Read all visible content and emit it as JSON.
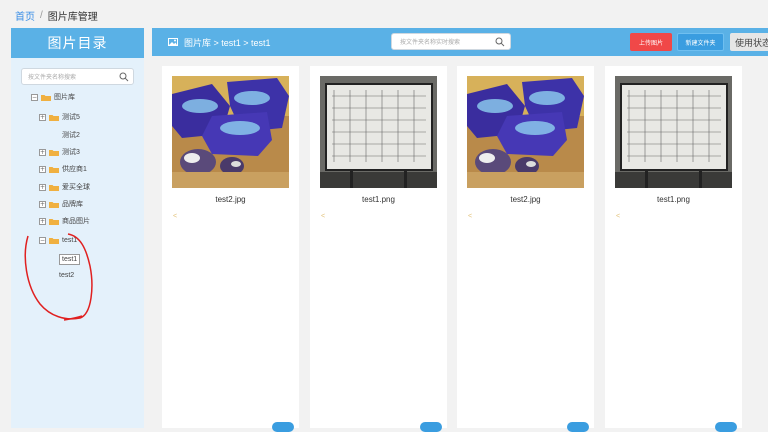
{
  "breadcrumb": {
    "home": "首页",
    "sep": "/",
    "current": "图片库管理"
  },
  "sidebar": {
    "title": "图片目录",
    "search_placeholder": "按文件夹名称搜索",
    "tree": [
      {
        "label": "图片库",
        "toggle": "−",
        "folder": true,
        "level": 0
      },
      {
        "label": "测试5",
        "toggle": "+",
        "folder": true,
        "level": 1
      },
      {
        "label": "测试2",
        "toggle": "",
        "folder": false,
        "level": 1
      },
      {
        "label": "测试3",
        "toggle": "+",
        "folder": true,
        "level": 1
      },
      {
        "label": "供应商1",
        "toggle": "+",
        "folder": true,
        "level": 1
      },
      {
        "label": "爱买全球",
        "toggle": "+",
        "folder": true,
        "level": 1
      },
      {
        "label": "品牌库",
        "toggle": "+",
        "folder": true,
        "level": 1
      },
      {
        "label": "商品图片",
        "toggle": "+",
        "folder": true,
        "level": 1
      },
      {
        "label": "test1",
        "toggle": "−",
        "folder": true,
        "level": 1
      },
      {
        "label": "test1",
        "toggle": "",
        "folder": false,
        "level": 2,
        "selected": true
      },
      {
        "label": "test2",
        "toggle": "",
        "folder": false,
        "level": 2
      }
    ]
  },
  "topbar": {
    "path": "图片库 > test1 > test1",
    "search_placeholder": "按文件夹名称实时搜索",
    "upload_label": "上传图片",
    "new_folder_label": "新建文件夹",
    "status_label": "使用状态"
  },
  "cards": [
    {
      "name": "test2.jpg",
      "image": "candy",
      "mark": "<"
    },
    {
      "name": "test1.png",
      "image": "whiteboard",
      "mark": "<"
    },
    {
      "name": "test2.jpg",
      "image": "candy",
      "mark": "<"
    },
    {
      "name": "test1.png",
      "image": "whiteboard",
      "mark": "<"
    }
  ],
  "colors": {
    "accent": "#5ab1e6",
    "upload": "#f04848",
    "new_folder": "#3a9de0",
    "annotation": "#e02020"
  }
}
